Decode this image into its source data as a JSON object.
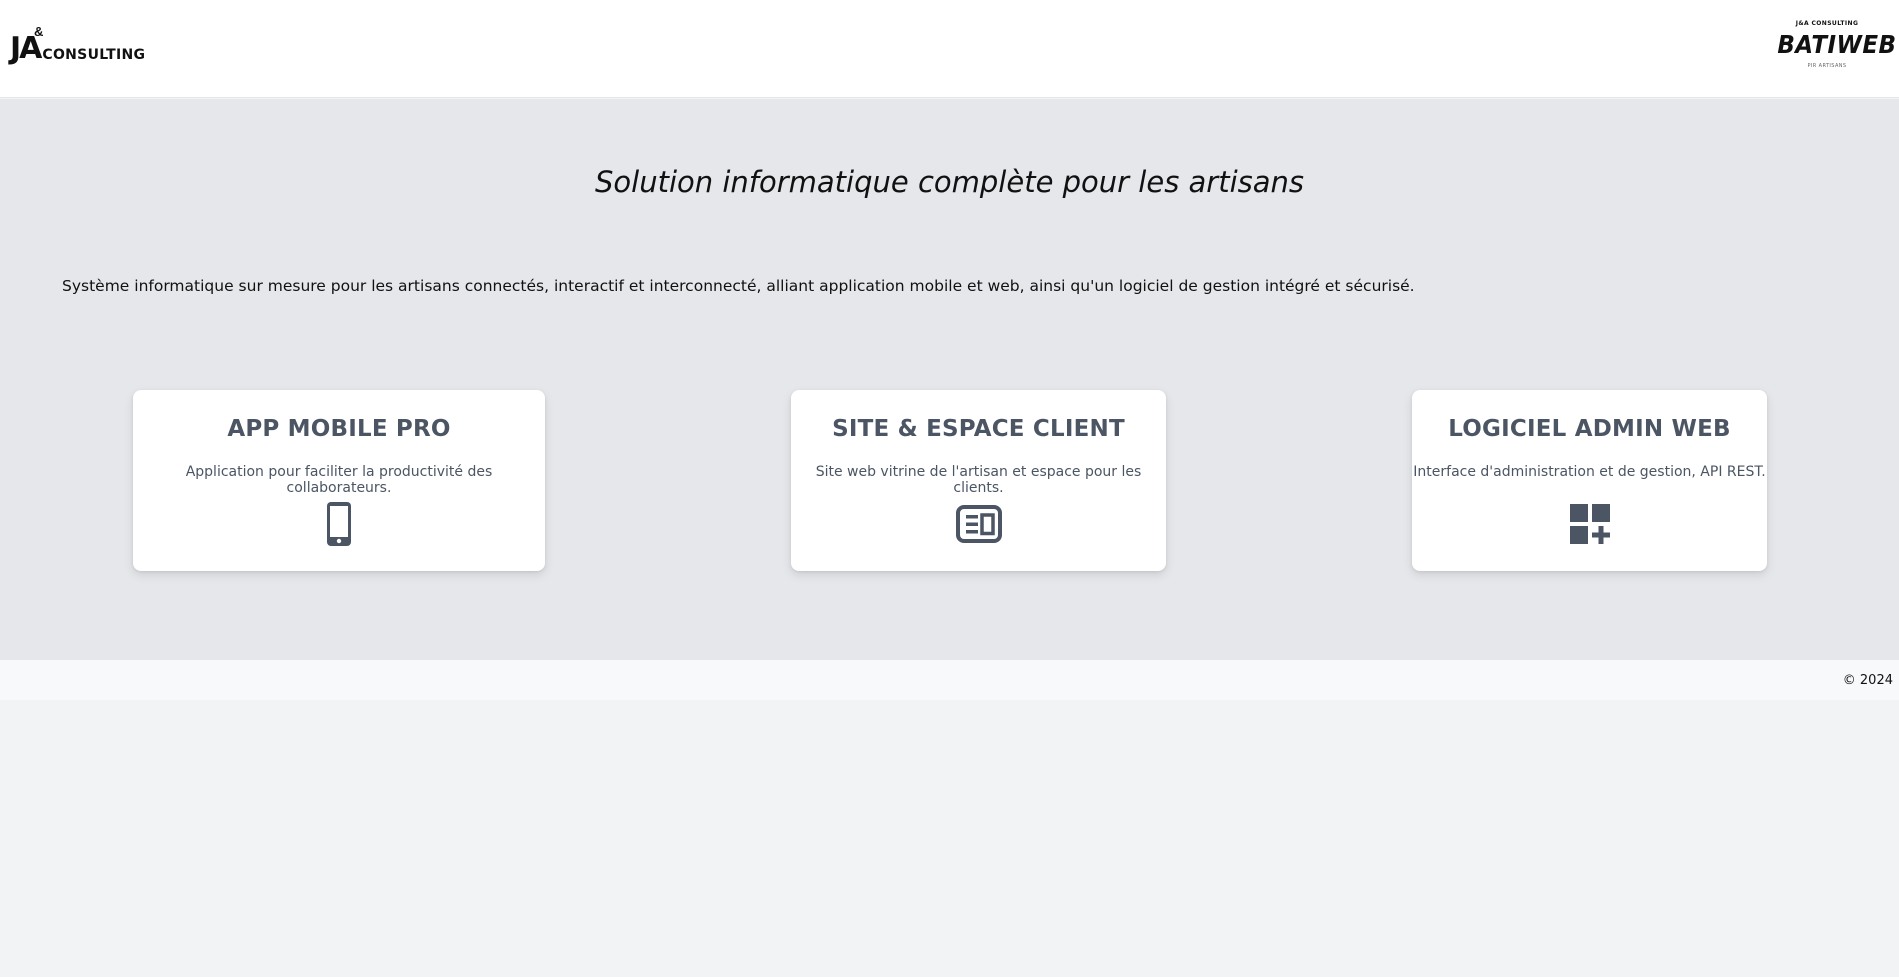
{
  "header": {
    "logo_left": {
      "ja": "JA",
      "amp": "&",
      "consulting": "CONSULTING"
    },
    "logo_right": {
      "top": "J&A CONSULTING",
      "main": "BATIWEB",
      "bottom": "PIR ARTISANS"
    }
  },
  "hero": {
    "title": "Solution informatique complète pour les artisans",
    "intro": "Système informatique sur mesure pour les artisans connectés, interactif et interconnecté, alliant application mobile et web, ainsi qu'un logiciel de gestion intégré et sécurisé."
  },
  "cards": [
    {
      "title": "APP MOBILE PRO",
      "description": "Application pour faciliter la productivité des collaborateurs.",
      "icon": "smartphone-icon"
    },
    {
      "title": "SITE & ESPACE CLIENT",
      "description": "Site web vitrine de l'artisan et espace pour les clients.",
      "icon": "newspaper-icon"
    },
    {
      "title": "LOGICIEL ADMIN WEB",
      "description": "Interface d'administration et de gestion, API REST.",
      "icon": "dashboard-add-icon"
    }
  ],
  "colors": {
    "card_text": "#4b5563",
    "main_bg": "#e5e7eb",
    "header_bg": "#ffffff",
    "footer_bg": "#f8f9fa"
  },
  "footer": {
    "copyright": "© 2024"
  }
}
